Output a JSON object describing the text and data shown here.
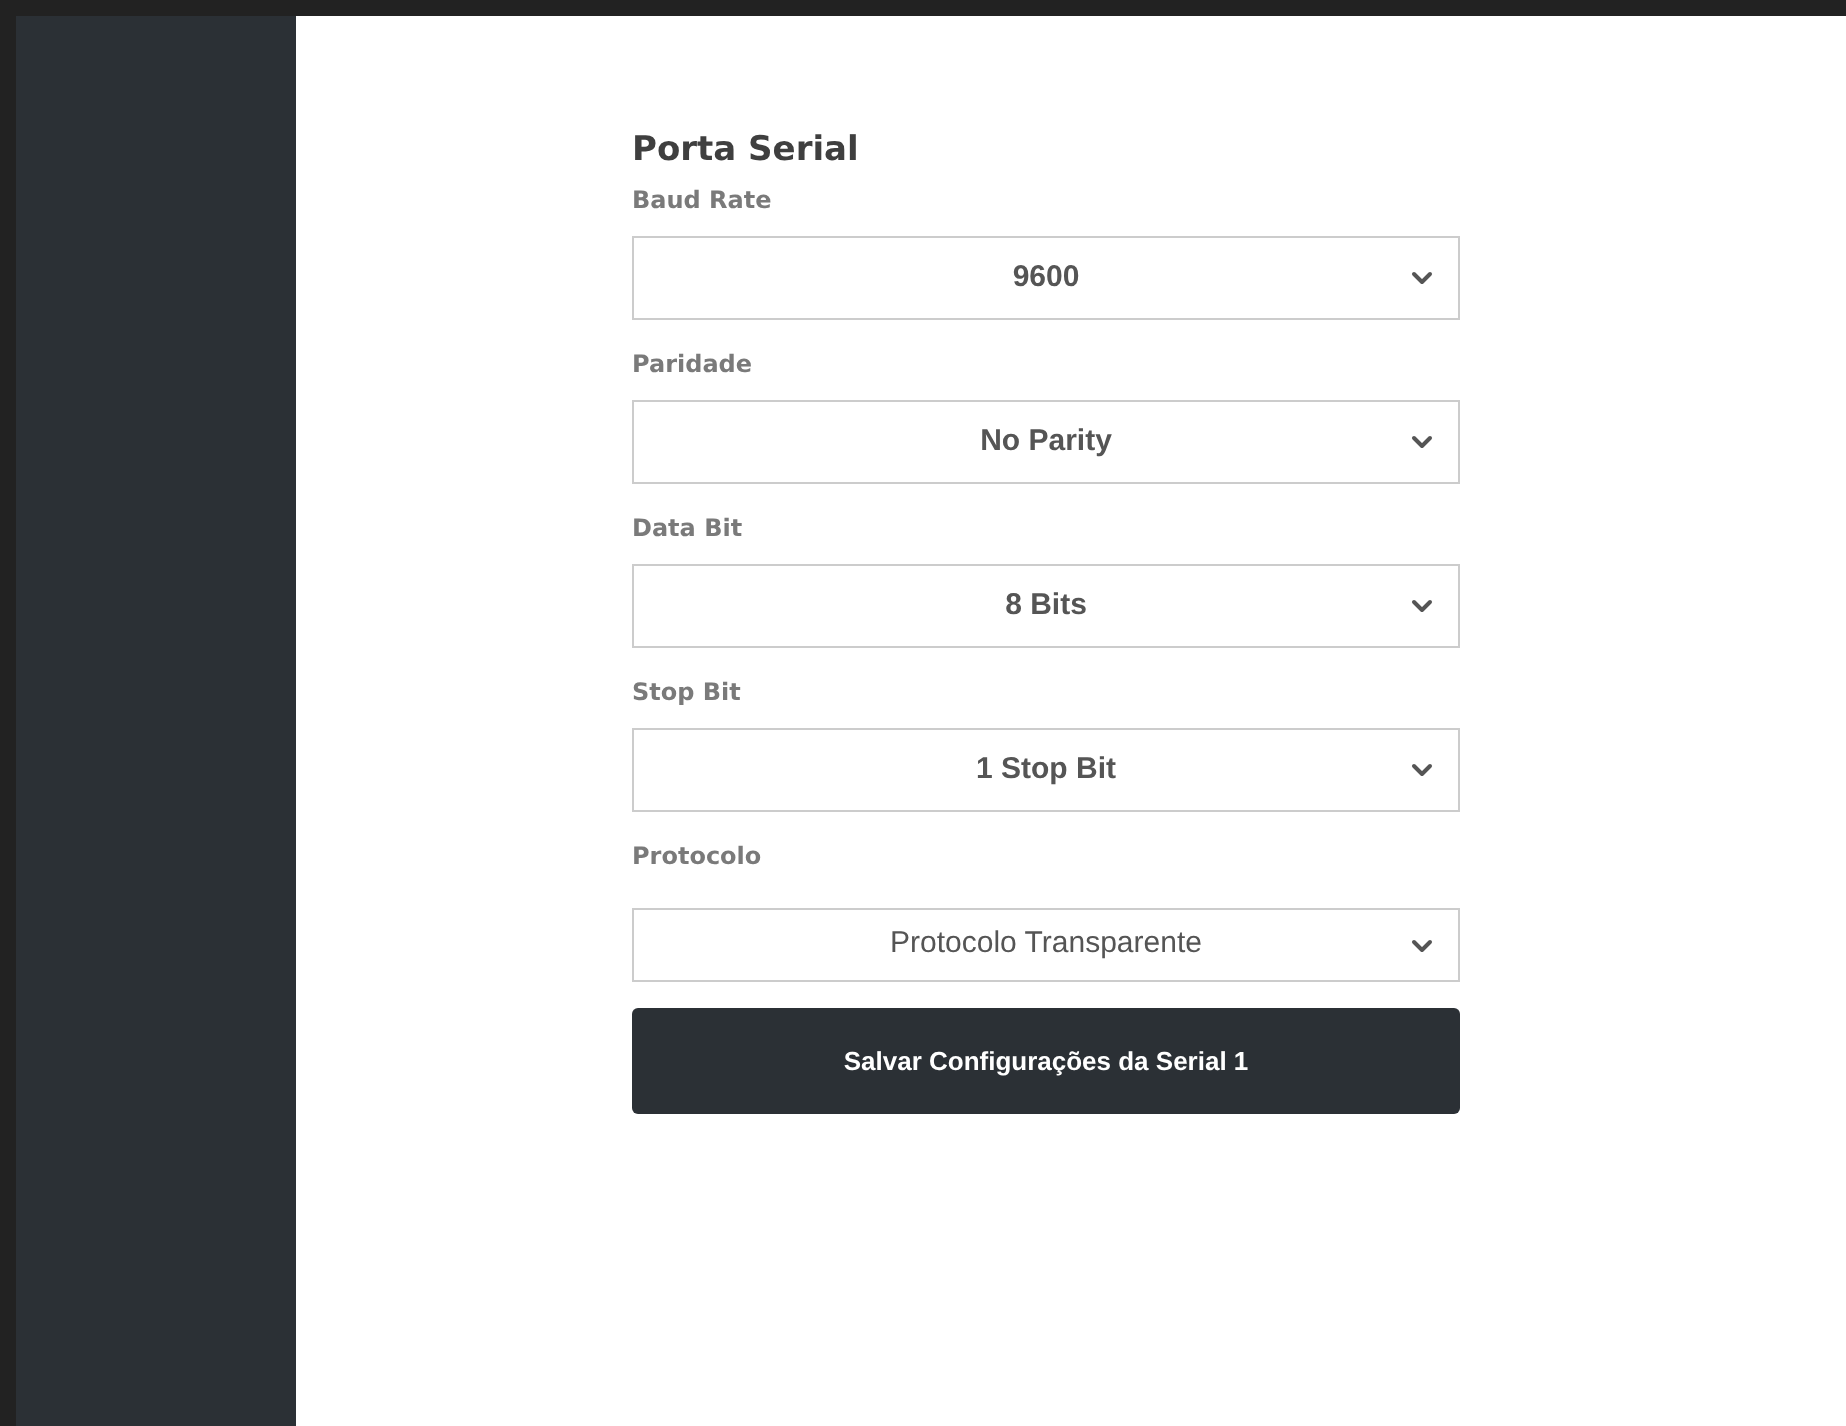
{
  "section": {
    "title": "Porta Serial"
  },
  "fields": [
    {
      "label": "Baud Rate",
      "value": "9600",
      "bold": true
    },
    {
      "label": "Paridade",
      "value": "No Parity",
      "bold": true
    },
    {
      "label": "Data Bit",
      "value": "8 Bits",
      "bold": true
    },
    {
      "label": "Stop Bit",
      "value": "1 Stop Bit",
      "bold": true
    },
    {
      "label": "Protocolo",
      "value": "Protocolo Transparente",
      "bold": false
    }
  ],
  "save_button": {
    "label": "Salvar Configurações da Serial 1"
  }
}
